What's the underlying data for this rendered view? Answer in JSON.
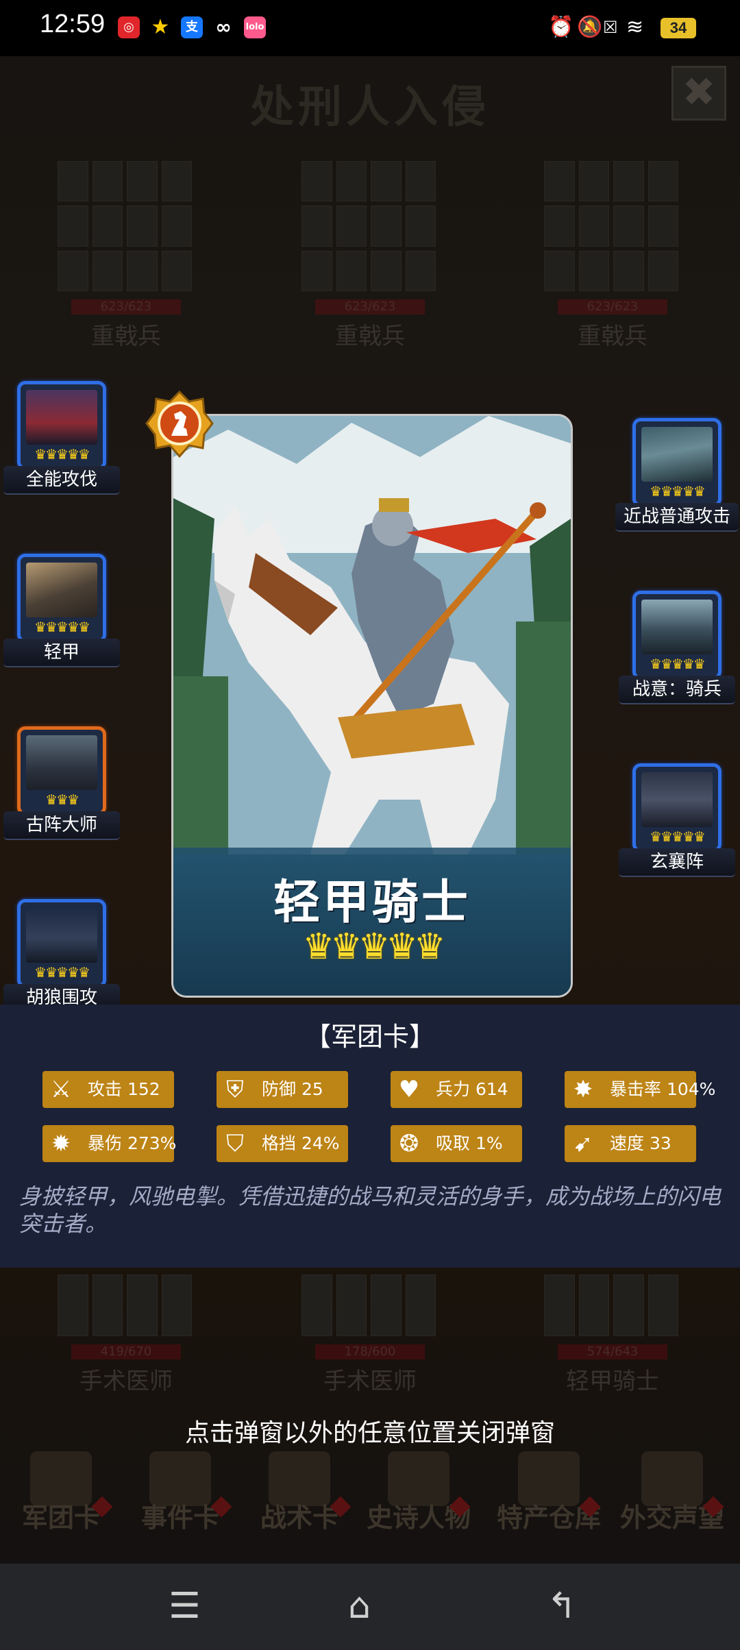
{
  "status_bar": {
    "time": "12:59",
    "battery": "34"
  },
  "background": {
    "title": "处刑人入侵",
    "enemies": [
      {
        "hp": "623/623",
        "name": "重戟兵"
      },
      {
        "hp": "623/623",
        "name": "重戟兵"
      },
      {
        "hp": "623/623",
        "name": "重戟兵"
      }
    ],
    "allies": [
      {
        "hp": "419/670",
        "name": "手术医师"
      },
      {
        "hp": "178/600",
        "name": "手术医师"
      },
      {
        "hp": "574/643",
        "name": "轻甲骑士"
      }
    ]
  },
  "skills_left": [
    {
      "label": "全能攻伐",
      "frame": "blue"
    },
    {
      "label": "轻甲",
      "frame": "blue"
    },
    {
      "label": "古阵大师",
      "frame": "orange"
    },
    {
      "label": "胡狼围攻",
      "frame": "blue"
    }
  ],
  "skills_right": [
    {
      "label": "近战普通攻击",
      "frame": "blue"
    },
    {
      "label": "战意：骑兵",
      "frame": "blue"
    },
    {
      "label": "玄襄阵",
      "frame": "blue"
    }
  ],
  "card": {
    "name": "轻甲骑士",
    "stars": "♛♛♛♛♛",
    "stars_count": 5,
    "type_label": "【军团卡】",
    "description": "身披轻甲，风驰电掣。凭借迅捷的战马和灵活的身手，成为战场上的闪电突击者。",
    "stats": [
      {
        "icon": "sword-icon",
        "glyph": "⚔",
        "label": "攻击 152"
      },
      {
        "icon": "shield-icon",
        "glyph": "⛨",
        "label": "防御 25"
      },
      {
        "icon": "heart-icon",
        "glyph": "♥",
        "label": "兵力 614"
      },
      {
        "icon": "crit-icon",
        "glyph": "✸",
        "label": "暴击率 104%"
      },
      {
        "icon": "crit-damage-icon",
        "glyph": "✹",
        "label": "暴伤 273%"
      },
      {
        "icon": "block-icon",
        "glyph": "⛉",
        "label": "格挡 24%"
      },
      {
        "icon": "lifesteal-icon",
        "glyph": "❂",
        "label": "吸取 1%"
      },
      {
        "icon": "speed-icon",
        "glyph": "➹",
        "label": "速度 33"
      }
    ]
  },
  "hint": "点击弹窗以外的任意位置关闭弹窗",
  "bottom_tabs": [
    "军团卡",
    "事件卡",
    "战术卡",
    "史诗人物",
    "特产仓库",
    "外交声望"
  ],
  "colors": {
    "skill_frame_blue": "#2f6fe6",
    "skill_frame_orange": "#e06a1c",
    "stat_bg": "#bd8416",
    "panel_bg": "#1b2136",
    "crown_gold": "#ffd21a"
  }
}
